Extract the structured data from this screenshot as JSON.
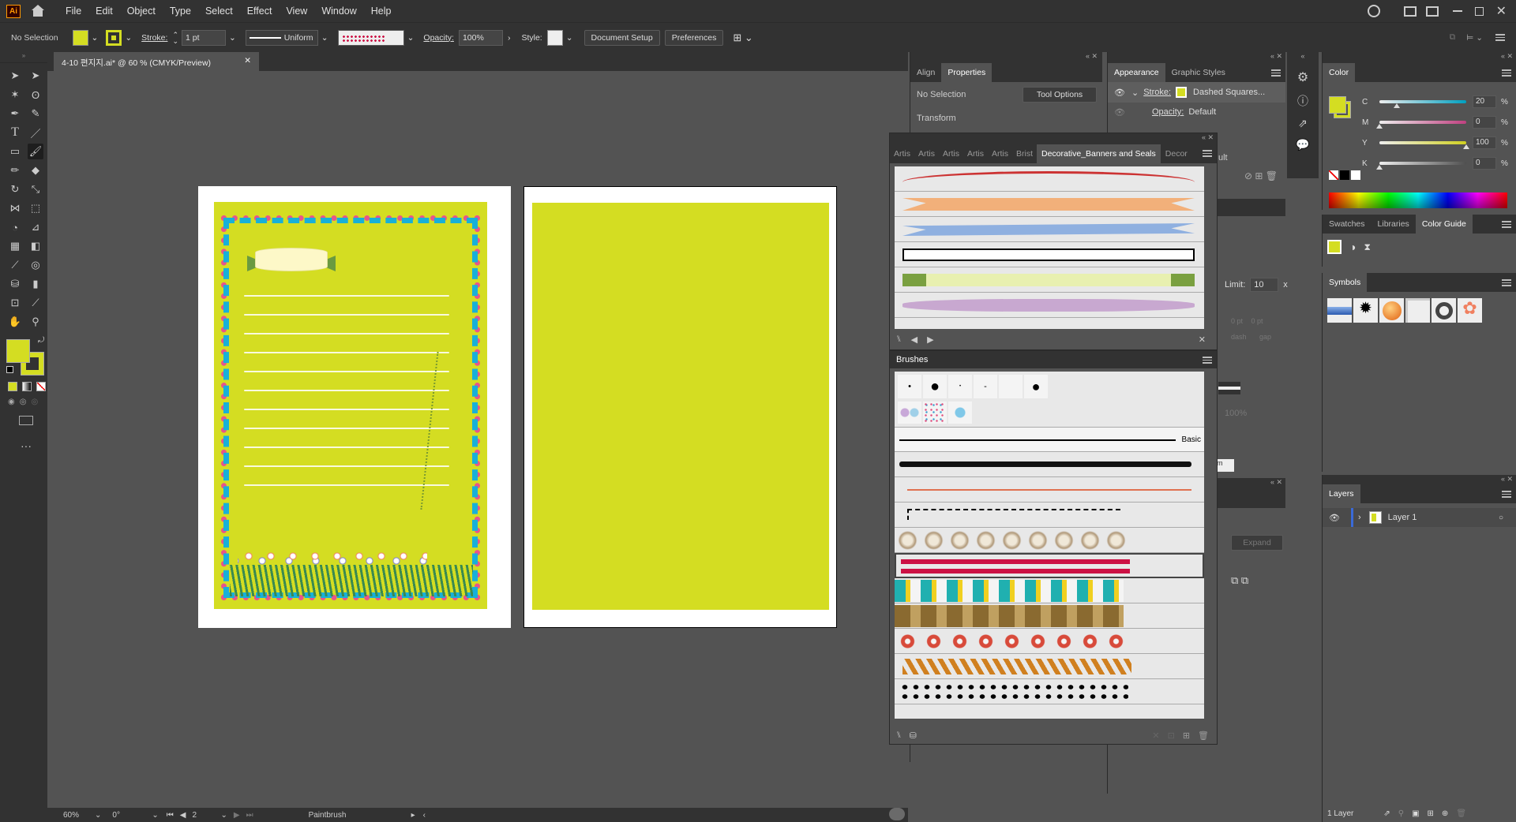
{
  "app": {
    "logo": "Ai",
    "menus": [
      "File",
      "Edit",
      "Object",
      "Type",
      "Select",
      "Effect",
      "View",
      "Window",
      "Help"
    ]
  },
  "options": {
    "selection": "No Selection",
    "stroke_label": "Stroke:",
    "stroke_weight": "1 pt",
    "profile": "Uniform",
    "opacity_label": "Opacity:",
    "opacity": "100%",
    "style_label": "Style:",
    "doc_setup": "Document Setup",
    "preferences": "Preferences",
    "fill_color": "#d4dd22"
  },
  "doc": {
    "tab": "4-10 편지지.ai* @ 60 % (CMYK/Preview)",
    "page_color": "#d4dd22",
    "border_pink": "#e8558a",
    "border_cyan": "#18b0d8"
  },
  "status": {
    "zoom": "60%",
    "rotate": "0°",
    "artboard": "2",
    "tool": "Paintbrush"
  },
  "props": {
    "tabs": [
      "Align",
      "Properties"
    ],
    "selection": "No Selection",
    "tool_options": "Tool Options",
    "transform": "Transform"
  },
  "appearance": {
    "tabs": [
      "Appearance",
      "Graphic Styles"
    ],
    "stroke_label": "Stroke:",
    "stroke_value": "Dashed Squares...",
    "opacity_label": "Opacity:",
    "opacity_value": "Default",
    "fill_frag": "ult"
  },
  "brushlib": {
    "tabs": [
      "Artis",
      "Artis",
      "Artis",
      "Artis",
      "Artis",
      "Brist",
      "Decorative_Banners and Seals",
      "Decor"
    ],
    "ribbons": [
      "#cc3333",
      "#f2b07a",
      "#8fb0e0",
      "#ffffff",
      "#e8f0b0",
      "#c8a8d0"
    ]
  },
  "brushes": {
    "title": "Brushes",
    "basic": "Basic"
  },
  "stroke_frag": {
    "limit_label": "Limit:",
    "limit_value": "10",
    "unit_x": "x",
    "dash": "dash",
    "gap": "gap",
    "pt": "0 pt",
    "pct": "100%",
    "expand": "Expand",
    "m": "m"
  },
  "color": {
    "title": "Color",
    "channels": [
      {
        "k": "C",
        "v": "20",
        "pos": 0.2,
        "col": "#00a0c0"
      },
      {
        "k": "M",
        "v": "0",
        "pos": 0,
        "col": "#c04080"
      },
      {
        "k": "Y",
        "v": "100",
        "pos": 1,
        "col": "#d0d020"
      },
      {
        "k": "K",
        "v": "0",
        "pos": 0,
        "col": "#505050"
      }
    ],
    "pct": "%",
    "swatch": "#d4dd22"
  },
  "guide": {
    "tabs": [
      "Swatches",
      "Libraries",
      "Color Guide"
    ]
  },
  "symbols": {
    "title": "Symbols"
  },
  "layers": {
    "title": "Layers",
    "layer": "Layer 1",
    "count": "1 Layer"
  }
}
